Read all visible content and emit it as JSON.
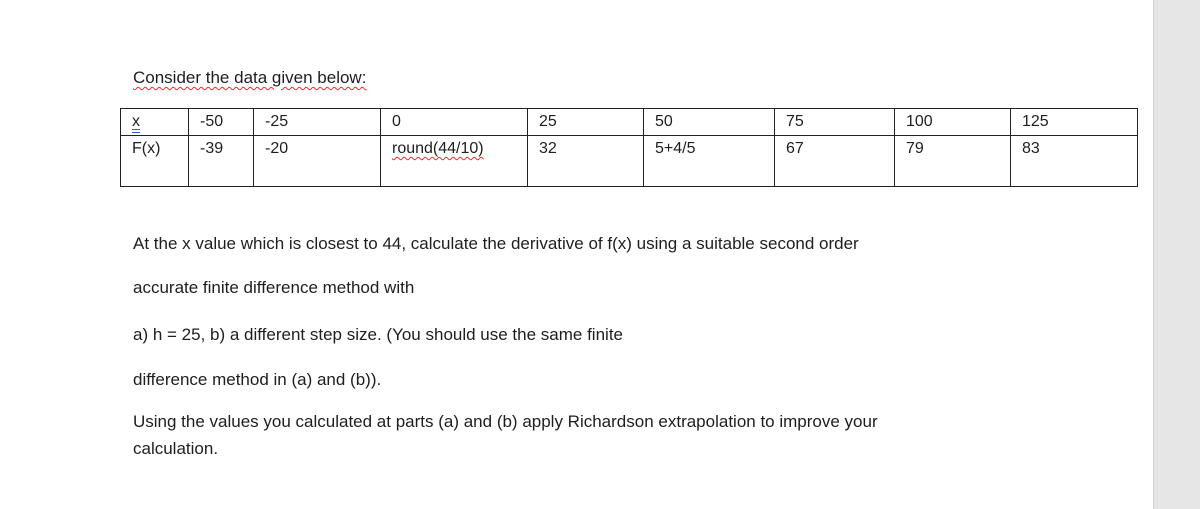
{
  "intro": "Consider the data given below:",
  "table": {
    "rows": [
      {
        "label": "x",
        "values": [
          "-50",
          "-25",
          "0",
          "25",
          "50",
          "75",
          "100",
          "125"
        ]
      },
      {
        "label": "F(x)",
        "values": [
          "-39",
          "-20",
          "round(44/10)",
          "32",
          "5+4/5",
          "67",
          "79",
          "83"
        ]
      }
    ]
  },
  "paragraphs": [
    "At the x value which is closest to 44, calculate the derivative of f(x) using a suitable second order",
    "accurate finite difference method with",
    "a) h = 25, b) a different step size. (You should use the same finite",
    "difference method in (a) and (b)).",
    "Using the values you calculated at parts (a) and (b) apply Richardson extrapolation to improve your",
    "calculation."
  ]
}
